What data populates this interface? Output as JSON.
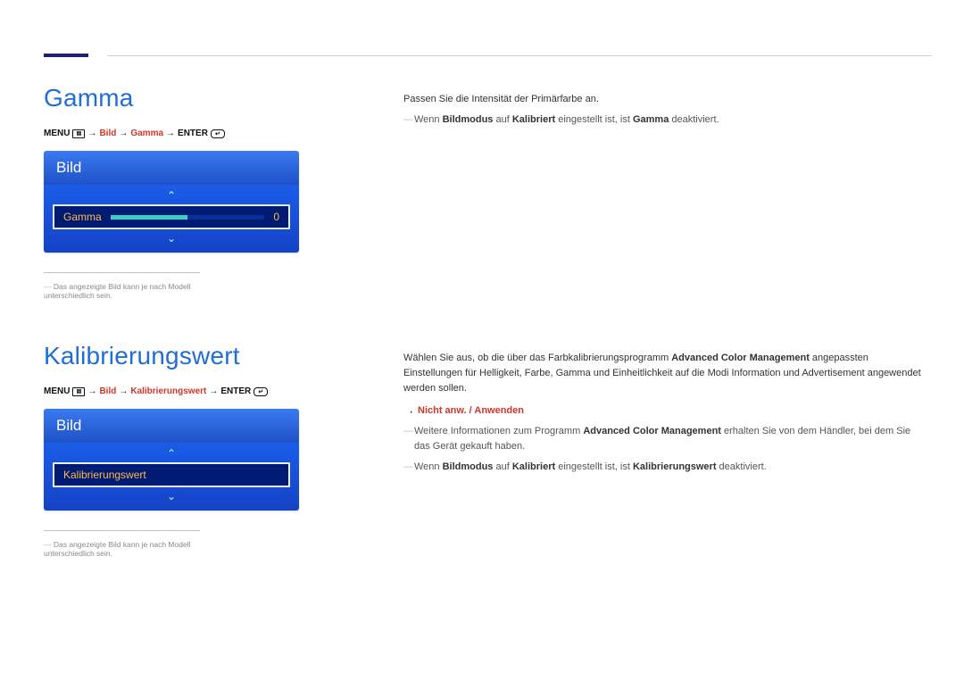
{
  "topbar": {
    "has_mark": true
  },
  "left1": {
    "heading": "Gamma",
    "menu_label": "MENU",
    "nav1": "Bild",
    "nav2": "Gamma",
    "enter_label": "ENTER",
    "osd_title": "Bild",
    "row_label": "Gamma",
    "row_value": "0",
    "caption": "Das angezeigte Bild kann je nach Modell unterschiedlich sein."
  },
  "left2": {
    "heading": "Kalibrierungswert",
    "menu_label": "MENU",
    "nav1": "Bild",
    "nav2": "Kalibrierungswert",
    "enter_label": "ENTER",
    "osd_title": "Bild",
    "row_label": "Kalibrierungswert",
    "caption": "Das angezeigte Bild kann je nach Modell unterschiedlich sein."
  },
  "right1": {
    "lead": "Passen Sie die Intensität der Primärfarbe an.",
    "note_pre": "Wenn ",
    "note_b1": "Bildmodus",
    "note_mid": " auf ",
    "note_b2": "Kalibriert",
    "note_post1": " eingestellt ist, ist ",
    "note_b3": "Gamma",
    "note_post2": " deaktiviert."
  },
  "right2": {
    "p1a": "Wählen Sie aus, ob die über das Farbkalibrierungsprogramm ",
    "p1b": "Advanced Color Management",
    "p1c": " angepassten Einstellungen für Helligkeit, Farbe, Gamma und Einheitlichkeit auf die Modi Information und Advertisement angewendet werden sollen.",
    "options_a": "Nicht anw.",
    "options_sep": " / ",
    "options_b": "Anwenden",
    "n1a": "Weitere Informationen zum Programm ",
    "n1b": "Advanced Color Management",
    "n1c": " erhalten Sie von dem Händler, bei dem Sie das Gerät gekauft haben.",
    "n2a": "Wenn ",
    "n2b": "Bildmodus",
    "n2c": " auf ",
    "n2d": "Kalibriert",
    "n2e": " eingestellt ist, ist ",
    "n2f": "Kalibrierungswert",
    "n2g": " deaktiviert."
  }
}
